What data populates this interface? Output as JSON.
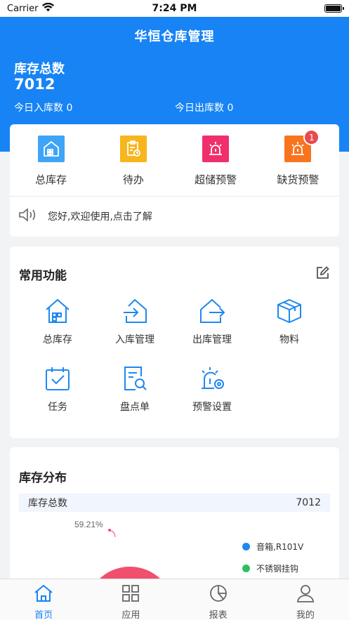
{
  "status_bar": {
    "carrier": "Carrier",
    "time": "7:24 PM"
  },
  "header": {
    "title": "华恒仓库管理"
  },
  "summary": {
    "stock_label": "库存总数",
    "stock_total": "7012",
    "today_in": "今日入库数 0",
    "today_out": "今日出库数 0"
  },
  "quick_actions": [
    {
      "label": "总库存",
      "icon": "warehouse-icon",
      "color": "#3ea4f8"
    },
    {
      "label": "待办",
      "icon": "clipboard-clock-icon",
      "color": "#f7b51e"
    },
    {
      "label": "超储预警",
      "icon": "alarm-light-icon",
      "color": "#f0306c"
    },
    {
      "label": "缺货预警",
      "icon": "alarm-light-icon",
      "color": "#f8741e",
      "badge": "1"
    }
  ],
  "notice": {
    "text": "您好,欢迎使用,点击了解",
    "icon": "speaker-icon"
  },
  "functions": {
    "title": "常用功能",
    "edit_icon": "edit-icon",
    "items": [
      {
        "label": "总库存",
        "icon": "warehouse-icon"
      },
      {
        "label": "入库管理",
        "icon": "inbound-icon"
      },
      {
        "label": "出库管理",
        "icon": "outbound-icon"
      },
      {
        "label": "物料",
        "icon": "box-icon"
      },
      {
        "label": "任务",
        "icon": "calendar-check-icon"
      },
      {
        "label": "盘点单",
        "icon": "document-search-icon"
      },
      {
        "label": "预警设置",
        "icon": "alarm-settings-icon"
      }
    ]
  },
  "distribution": {
    "title": "库存分布",
    "header_label": "库存总数",
    "header_value": "7012",
    "chart_data": {
      "type": "pie",
      "slices": [
        {
          "name": "音箱,R101V",
          "percent": 59.21,
          "color": "#f0506e"
        },
        {
          "name": "不锈钢挂钩",
          "percent": null,
          "color": "#2bc25b"
        }
      ],
      "data_label": "59.21%"
    },
    "legend_color_1": "#1e88f0"
  },
  "tab_bar": {
    "tabs": [
      {
        "label": "首页",
        "icon": "home-icon",
        "active": true
      },
      {
        "label": "应用",
        "icon": "grid-icon",
        "active": false
      },
      {
        "label": "报表",
        "icon": "pie-chart-icon",
        "active": false
      },
      {
        "label": "我的",
        "icon": "user-icon",
        "active": false
      }
    ]
  },
  "colors": {
    "primary": "#1783f5",
    "badge": "#e84a4e"
  }
}
